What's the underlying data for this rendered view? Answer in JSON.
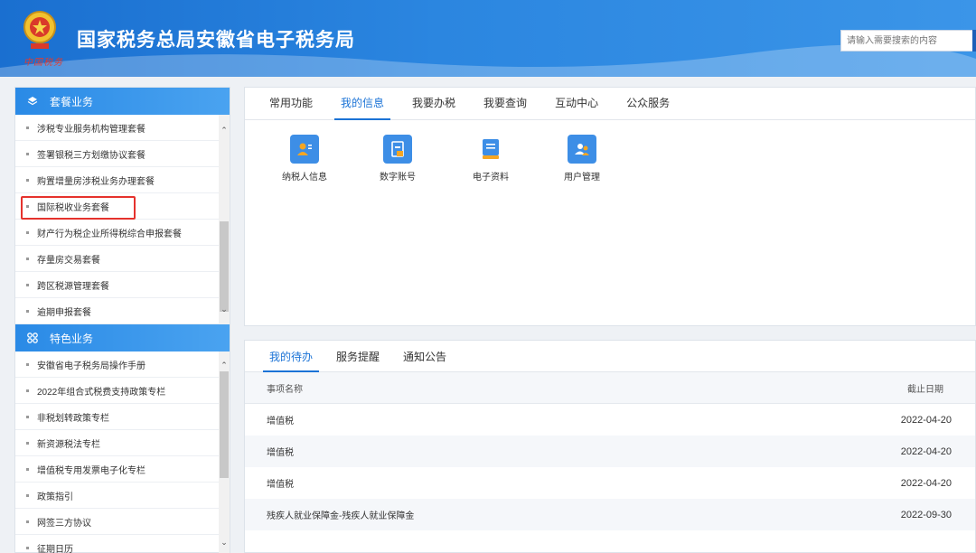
{
  "header": {
    "title": "国家税务总局安徽省电子税务局",
    "emblem_caption": "中国税务",
    "search_placeholder": "请输入需要搜索的内容"
  },
  "sidebar": {
    "groups": [
      {
        "title": "套餐业务",
        "icon": "layers-icon",
        "items": [
          "涉税专业服务机构管理套餐",
          "签署银税三方划缴协议套餐",
          "购置增量房涉税业务办理套餐",
          "国际税收业务套餐",
          "财产行为税企业所得税综合申报套餐",
          "存量房交易套餐",
          "跨区税源管理套餐",
          "逾期申报套餐"
        ]
      },
      {
        "title": "特色业务",
        "icon": "grid-icon",
        "items": [
          "安徽省电子税务局操作手册",
          "2022年组合式税费支持政策专栏",
          "非税划转政策专栏",
          "新资源税法专栏",
          "增值税专用发票电子化专栏",
          "政策指引",
          "网签三方协议",
          "征期日历"
        ]
      }
    ]
  },
  "top_panel": {
    "tabs": [
      "常用功能",
      "我的信息",
      "我要办税",
      "我要查询",
      "互动中心",
      "公众服务"
    ],
    "active_tab": "我的信息",
    "apps": [
      {
        "label": "纳税人信息",
        "icon": "taxpayer-info-icon"
      },
      {
        "label": "数字账号",
        "icon": "digital-account-icon"
      },
      {
        "label": "电子资料",
        "icon": "electronic-docs-icon"
      },
      {
        "label": "用户管理",
        "icon": "user-management-icon"
      }
    ]
  },
  "bottom_panel": {
    "tabs": [
      "我的待办",
      "服务提醒",
      "通知公告"
    ],
    "active_tab": "我的待办",
    "columns": [
      "事项名称",
      "截止日期"
    ],
    "rows": [
      {
        "name": "增值税",
        "deadline": "2022-04-20"
      },
      {
        "name": "增值税",
        "deadline": "2022-04-20"
      },
      {
        "name": "增值税",
        "deadline": "2022-04-20"
      },
      {
        "name": "残疾人就业保障金-残疾人就业保障金",
        "deadline": "2022-09-30"
      }
    ]
  },
  "colors": {
    "accent": "#1b73d6",
    "header_blue": "#2b86e0",
    "highlight_red": "#e5322d",
    "icon_blue": "#3d8ee6",
    "icon_orange": "#f5a623"
  }
}
